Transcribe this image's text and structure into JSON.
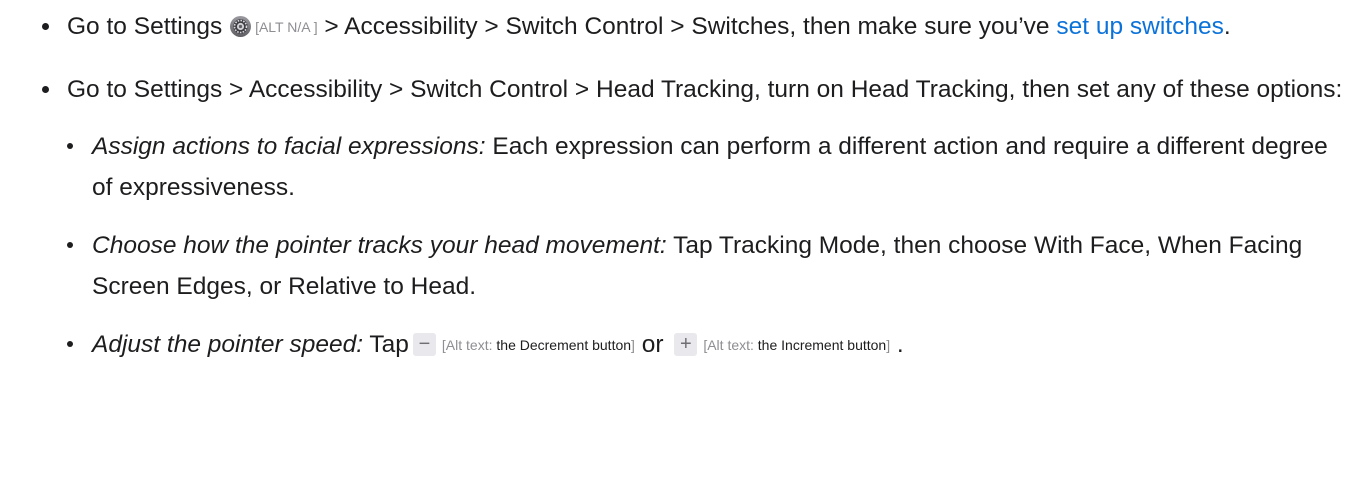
{
  "items": [
    {
      "text_before_icon": "Go to Settings",
      "icon": "settings-gear-icon",
      "alt_text": "[ALT N/A ]",
      "text_after_icon": " > Accessibility > Switch Control > Switches, then make sure you’ve ",
      "link": "set up switches",
      "text_end": "."
    },
    {
      "text": "Go to Settings > Accessibility > Switch Control > Head Tracking, turn on Head Tracking, then set any of these options:",
      "subitems": [
        {
          "label": "Assign actions to facial expressions:",
          "text": " Each expression can perform a different action and require a different degree of expressiveness."
        },
        {
          "label": "Choose how the pointer tracks your head movement:",
          "text": " Tap Tracking Mode, then choose With Face, When Facing Screen Edges, or Relative to Head."
        },
        {
          "label": "Adjust the pointer speed:",
          "text_tap": " Tap",
          "decrement_symbol": "−",
          "decrement_alt_prefix": "[Alt text: ",
          "decrement_alt_desc": "the Decrement button",
          "decrement_alt_suffix": "]",
          "or_word": " or ",
          "increment_symbol": "+",
          "increment_alt_prefix": "[Alt text: ",
          "increment_alt_desc": "the Increment button",
          "increment_alt_suffix": "]",
          "text_end": " ."
        }
      ]
    }
  ],
  "colors": {
    "text": "#1d1d1f",
    "link": "#0b72d9",
    "alt_text": "#8e8e93",
    "stepper_bg": "#e8e8ed"
  }
}
